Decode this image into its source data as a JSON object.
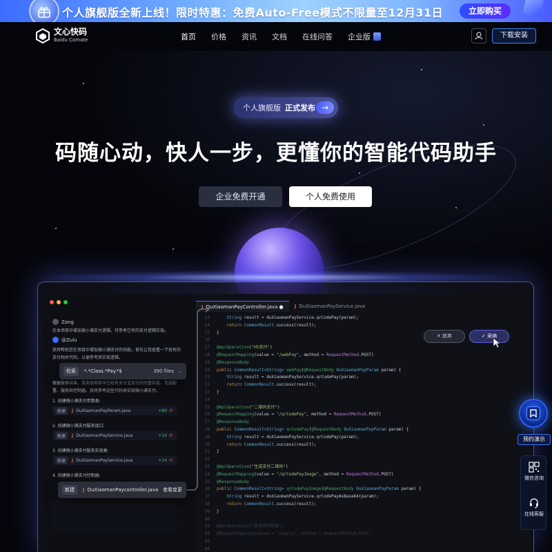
{
  "banner": {
    "text": "个人旗舰版全新上线！限时特惠：免费Auto-Free模式不限量至12月31日",
    "buy_label": "立即购买"
  },
  "nav": {
    "logo_cn": "文心快码",
    "logo_en": "Baidu Comate",
    "links": [
      "首页",
      "价格",
      "资讯",
      "文档",
      "在线问答",
      "企业版"
    ],
    "download_label": "下载安装"
  },
  "hero": {
    "pill_a": "个人旗舰版",
    "pill_b": "正式发布",
    "pill_arrow": "→",
    "headline": "码随心动，快人一步，更懂你的智能代码助手",
    "btn_enterprise": "企业免费开通",
    "btn_personal": "个人免费使用"
  },
  "ide": {
    "chat": {
      "user1": "Zang",
      "user1_msg": "在本项目中增加微小满支付逻辑。可参考已有的支付逻辑实现。",
      "user2": "@Zulu",
      "user2_msg": "我将帮助您在项目中增加微小满支付的功能。首先让我查看一下现有的支付相关代码，以便参考其实现逻辑。",
      "user2_msg2": "根据搜索结果，我发现项目中已经有支付宝支付的完整实现，包括配置、服务和控制器。我将参考这些代码来实现微小满支付。",
      "steps": [
        "1. 创建微小满支付参数类:",
        "2. 创建微小满支付服务接口:",
        "3. 创建微小满支付服务实现类:",
        "4. 创建微小满支付控制器:"
      ],
      "files": [
        {
          "tag": "新建",
          "name": "DuXiaomanPayParam.java",
          "add": "+80",
          "del": "-0"
        },
        {
          "tag": "新建",
          "name": "DuXiaomanPayService.java",
          "add": "+14",
          "del": "-0"
        },
        {
          "tag": "新建",
          "name": "DuXiaomanPayService.java",
          "add": "+14",
          "del": "-0"
        }
      ],
      "search_label": "检索",
      "search_query": "*.*Class.*Pay.*$",
      "search_count": "390 files",
      "new_label": "新建",
      "new_file": "DuXiaomanPaycontroller.java",
      "new_view": "查看变更"
    },
    "tabs": [
      "DuXiaomanPayController.java",
      "DuXiaomanPayService.java"
    ],
    "discard_label": "✕ 放弃",
    "accept_label": "✓ 采纳"
  },
  "float": {
    "demo_label": "预约演示",
    "wechat_label": "微信咨询",
    "service_label": "在线客服"
  },
  "colors": {
    "accent": "#4a6cff",
    "banner_start": "#3b6cff",
    "background": "#05060b"
  }
}
